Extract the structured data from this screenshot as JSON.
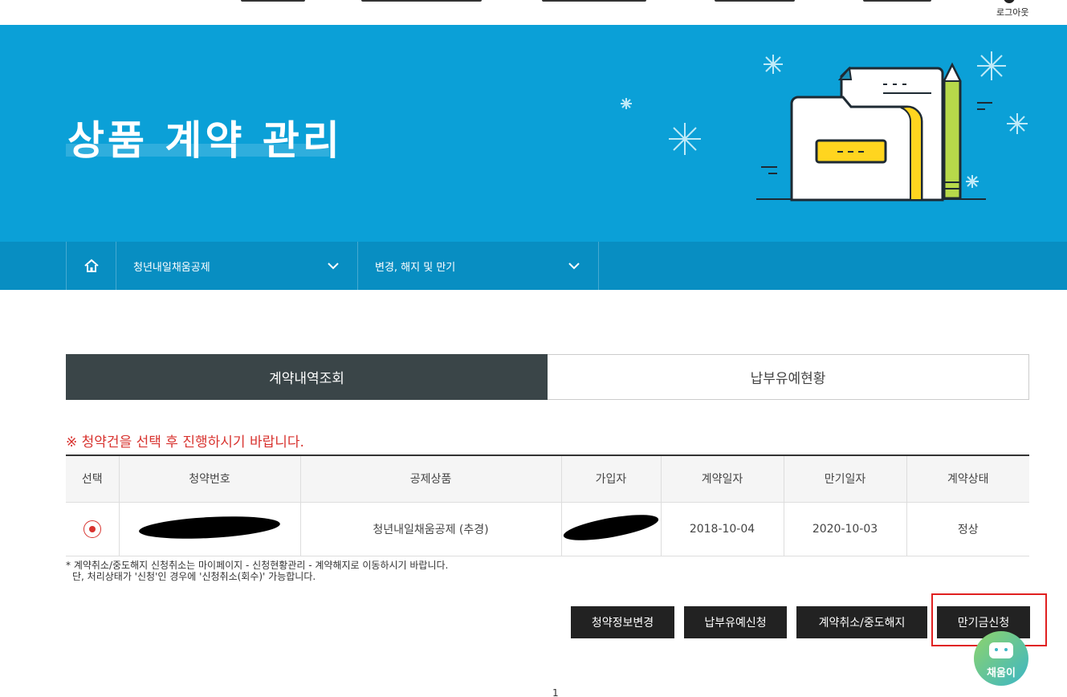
{
  "header": {
    "logout_label": "로그아웃"
  },
  "hero": {
    "title": "상품 계약 관리"
  },
  "breadcrumb": {
    "home_icon": "home-icon",
    "items": [
      {
        "label": "청년내일채움공제"
      },
      {
        "label": "변경, 해지 및 만기"
      }
    ]
  },
  "tabs": [
    {
      "label": "계약내역조회",
      "active": true
    },
    {
      "label": "납부유예현황",
      "active": false
    }
  ],
  "notice": "※ 청약건을 선택 후 진행하시기 바랍니다.",
  "table": {
    "headers": [
      "선택",
      "청약번호",
      "공제상품",
      "가입자",
      "계약일자",
      "만기일자",
      "계약상태"
    ],
    "rows": [
      {
        "product": "청년내일채움공제 (추경)",
        "contract_date": "2018-10-04",
        "maturity_date": "2020-10-03",
        "status": "정상"
      }
    ]
  },
  "footnote": {
    "line1": "* 계약취소/중도해지 신청취소는 마이페이지 - 신청현황관리 - 계약해지로 이동하시기 바랍니다.",
    "line2": "단, 처리상태가 '신청'인 경우에 '신청취소(회수)' 가능합니다."
  },
  "buttons": {
    "change_info": "청약정보변경",
    "defer_payment": "납부유예신청",
    "cancel_terminate": "계약취소/중도해지",
    "maturity_claim": "만기금신청"
  },
  "chatbot": {
    "label": "채움이"
  },
  "pagination": {
    "current": "1"
  },
  "colors": {
    "hero_bg": "#0ba0d7",
    "crumb_bg": "#088ec2",
    "accent_red": "#d8332f",
    "tab_active": "#3a4548"
  }
}
